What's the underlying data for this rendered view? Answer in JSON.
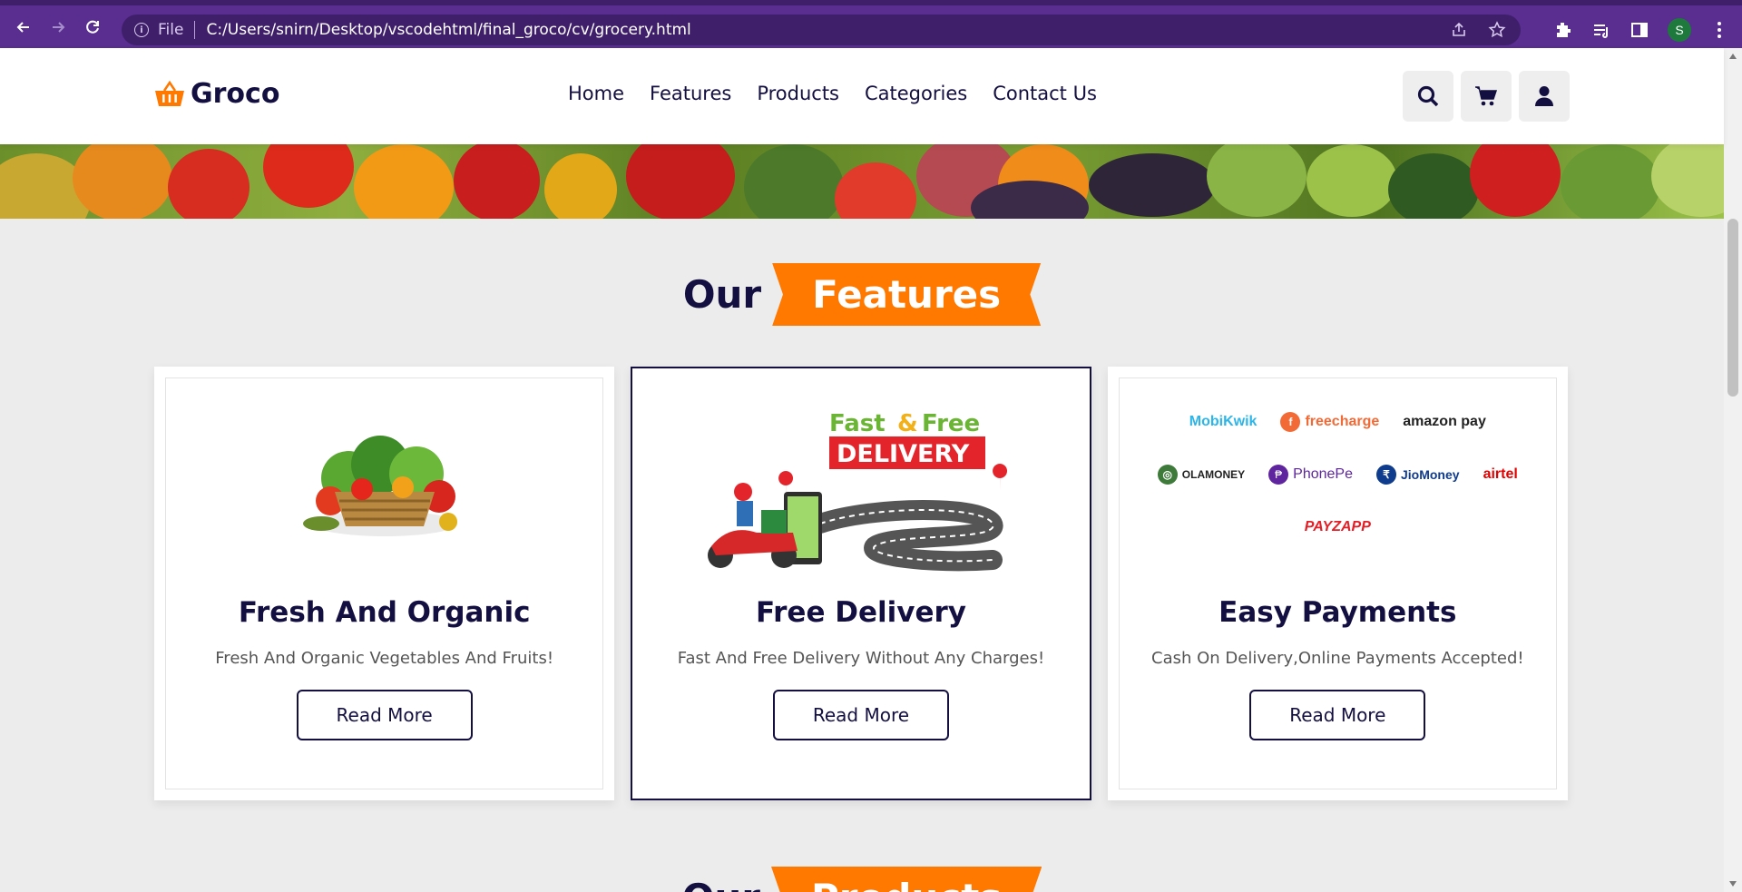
{
  "browser": {
    "file_label": "File",
    "url": "C:/Users/snirn/Desktop/vscodehtml/final_groco/cv/grocery.html",
    "profile_initial": "S"
  },
  "site": {
    "logo_text": "Groco",
    "nav": [
      "Home",
      "Features",
      "Products",
      "Categories",
      "Contact Us"
    ]
  },
  "features_heading": {
    "plain": "Our",
    "highlight": "Features"
  },
  "products_heading": {
    "plain": "Our",
    "highlight": "Products"
  },
  "cards": [
    {
      "title": "Fresh And Organic",
      "desc": "Fresh And Organic Vegetables And Fruits!",
      "button": "Read More"
    },
    {
      "title": "Free Delivery",
      "desc": "Fast And Free Delivery Without Any Charges!",
      "button": "Read More",
      "image_text": {
        "line1_a": "Fast",
        "line1_b": "&",
        "line1_c": "Free",
        "line2": "DELIVERY"
      }
    },
    {
      "title": "Easy Payments",
      "desc": "Cash On Delivery,Online Payments Accepted!",
      "button": "Read More"
    }
  ],
  "payments": [
    {
      "name": "MobiKwik",
      "color": "#2cb5e8"
    },
    {
      "name": "freecharge",
      "color": "#f26a36"
    },
    {
      "name": "amazon pay",
      "color": "#222222"
    },
    {
      "name": "OLAMONEY",
      "color": "#222222"
    },
    {
      "name": "PhonePe",
      "color": "#5f259f"
    },
    {
      "name": "JioMoney",
      "color": "#0f3c8c"
    },
    {
      "name": "airtel",
      "color": "#e40000"
    },
    {
      "name": "PAYZAPP",
      "color": "#e41e26"
    }
  ],
  "colors": {
    "brand": "#ff7800",
    "dark": "#130f40",
    "chrome": "#5a2d91"
  }
}
